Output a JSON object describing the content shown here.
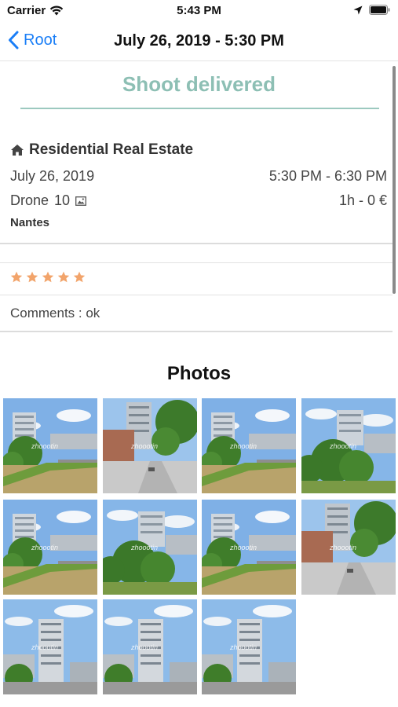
{
  "status": {
    "carrier": "Carrier",
    "time": "5:43 PM"
  },
  "nav": {
    "back_label": "Root",
    "title": "July 26, 2019 - 5:30 PM"
  },
  "shoot": {
    "status_title": "Shoot delivered",
    "type": "Residential Real Estate",
    "date": "July 26, 2019",
    "time_range": "5:30 PM - 6:30 PM",
    "service": "Drone",
    "photo_count": "10",
    "duration_price": "1h - 0 €",
    "city": "Nantes",
    "rating": 5,
    "comments": "Comments : ok"
  },
  "photos": {
    "title": "Photos",
    "watermark": "zhoootin",
    "items": [
      {
        "icon": "building-river-photo"
      },
      {
        "icon": "street-building-photo"
      },
      {
        "icon": "building-river-photo"
      },
      {
        "icon": "building-trees-photo"
      },
      {
        "icon": "building-river-photo"
      },
      {
        "icon": "building-trees-photo"
      },
      {
        "icon": "building-river-photo"
      },
      {
        "icon": "street-building-photo"
      },
      {
        "icon": "tower-photo"
      },
      {
        "icon": "tower-photo"
      },
      {
        "icon": "tower-photo"
      }
    ]
  },
  "colors": {
    "accent": "#1a7ef7",
    "delivered": "#8dbfb4",
    "star": "#f2a46b"
  }
}
